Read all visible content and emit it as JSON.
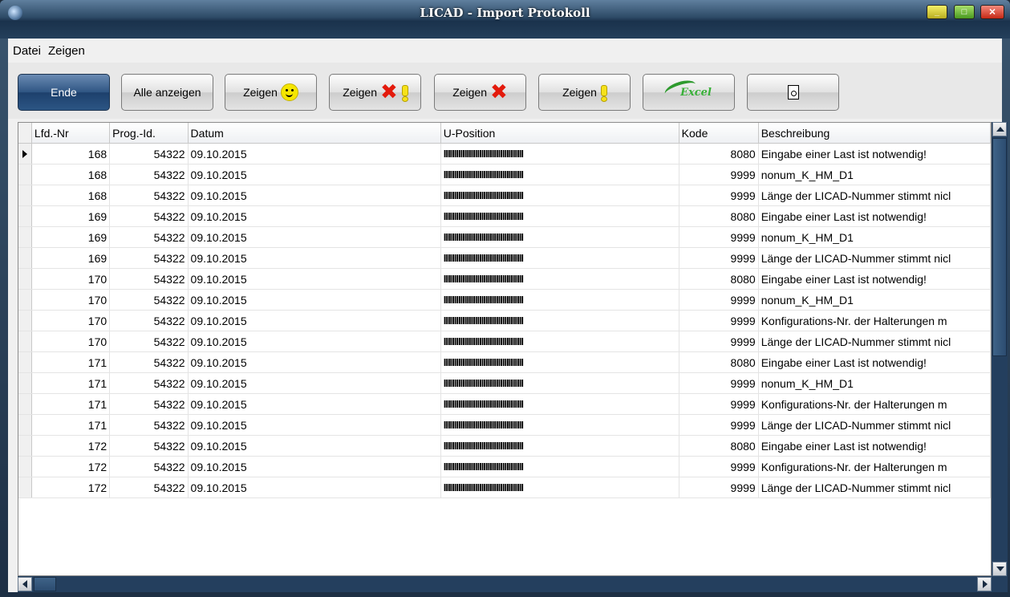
{
  "window": {
    "title": "LICAD - Import Protokoll"
  },
  "menu": {
    "items": [
      "Datei",
      "Zeigen"
    ]
  },
  "toolbar": {
    "ende_label": "Ende",
    "alle_label": "Alle anzeigen",
    "zeigen_label": "Zeigen",
    "excel_label": "Excel"
  },
  "table": {
    "columns": [
      "Lfd.-Nr",
      "Prog.-Id.",
      "Datum",
      "U-Position",
      "Kode",
      "Beschreibung"
    ],
    "rows": [
      [
        "168",
        "54322",
        "09.10.2015",
        "IIIIIIIIIIIIIIIIIIIIIIIIIIIIIIIIIIIIII",
        "8080",
        "Eingabe einer Last ist notwendig!"
      ],
      [
        "168",
        "54322",
        "09.10.2015",
        "IIIIIIIIIIIIIIIIIIIIIIIIIIIIIIIIIIIIII",
        "9999",
        "nonum_K_HM_D1"
      ],
      [
        "168",
        "54322",
        "09.10.2015",
        "IIIIIIIIIIIIIIIIIIIIIIIIIIIIIIIIIIIIII",
        "9999",
        "Länge der LICAD-Nummer stimmt nicl"
      ],
      [
        "169",
        "54322",
        "09.10.2015",
        "IIIIIIIIIIIIIIIIIIIIIIIIIIIIIIIIIIIIII",
        "8080",
        "Eingabe einer Last ist notwendig!"
      ],
      [
        "169",
        "54322",
        "09.10.2015",
        "IIIIIIIIIIIIIIIIIIIIIIIIIIIIIIIIIIIIII",
        "9999",
        "nonum_K_HM_D1"
      ],
      [
        "169",
        "54322",
        "09.10.2015",
        "IIIIIIIIIIIIIIIIIIIIIIIIIIIIIIIIIIIIII",
        "9999",
        "Länge der LICAD-Nummer stimmt nicl"
      ],
      [
        "170",
        "54322",
        "09.10.2015",
        "IIIIIIIIIIIIIIIIIIIIIIIIIIIIIIIIIIIIII",
        "8080",
        "Eingabe einer Last ist notwendig!"
      ],
      [
        "170",
        "54322",
        "09.10.2015",
        "IIIIIIIIIIIIIIIIIIIIIIIIIIIIIIIIIIIIII",
        "9999",
        "nonum_K_HM_D1"
      ],
      [
        "170",
        "54322",
        "09.10.2015",
        "IIIIIIIIIIIIIIIIIIIIIIIIIIIIIIIIIIIIII",
        "9999",
        "Konfigurations-Nr. der Halterungen m"
      ],
      [
        "170",
        "54322",
        "09.10.2015",
        "IIIIIIIIIIIIIIIIIIIIIIIIIIIIIIIIIIIIII",
        "9999",
        "Länge der LICAD-Nummer stimmt nicl"
      ],
      [
        "171",
        "54322",
        "09.10.2015",
        "IIIIIIIIIIIIIIIIIIIIIIIIIIIIIIIIIIIIII",
        "8080",
        "Eingabe einer Last ist notwendig!"
      ],
      [
        "171",
        "54322",
        "09.10.2015",
        "IIIIIIIIIIIIIIIIIIIIIIIIIIIIIIIIIIIIII",
        "9999",
        "nonum_K_HM_D1"
      ],
      [
        "171",
        "54322",
        "09.10.2015",
        "IIIIIIIIIIIIIIIIIIIIIIIIIIIIIIIIIIIIII",
        "9999",
        "Konfigurations-Nr. der Halterungen m"
      ],
      [
        "171",
        "54322",
        "09.10.2015",
        "IIIIIIIIIIIIIIIIIIIIIIIIIIIIIIIIIIIIII",
        "9999",
        "Länge der LICAD-Nummer stimmt nicl"
      ],
      [
        "172",
        "54322",
        "09.10.2015",
        "IIIIIIIIIIIIIIIIIIIIIIIIIIIIIIIIIIIIII",
        "8080",
        "Eingabe einer Last ist notwendig!"
      ],
      [
        "172",
        "54322",
        "09.10.2015",
        "IIIIIIIIIIIIIIIIIIIIIIIIIIIIIIIIIIIIII",
        "9999",
        "Konfigurations-Nr. der Halterungen m"
      ],
      [
        "172",
        "54322",
        "09.10.2015",
        "IIIIIIIIIIIIIIIIIIIIIIIIIIIIIIIIIIIIII",
        "9999",
        "Länge der LICAD-Nummer stimmt nicl"
      ]
    ]
  },
  "icons": {
    "ok": "smiley-icon",
    "error_warning": "error-warning-icon",
    "error": "error-x-icon",
    "warning": "warning-exclamation-icon",
    "excel": "excel-icon",
    "preview": "print-preview-icon"
  },
  "colors": {
    "accent": "#2f5583",
    "error": "#e31a0c",
    "warning": "#f6e21a",
    "ok": "#f5e600"
  }
}
